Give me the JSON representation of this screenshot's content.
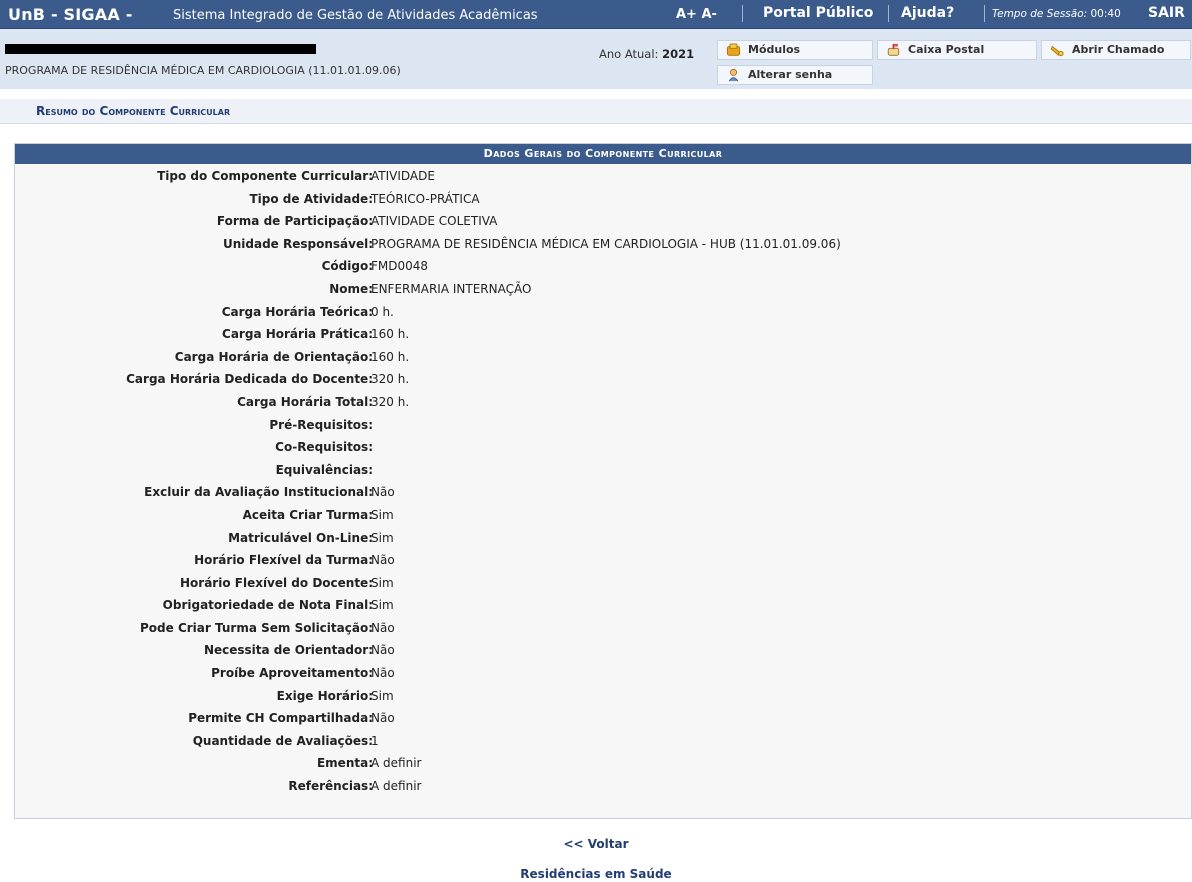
{
  "topbar": {
    "system": "UnB - SIGAA -",
    "system_desc": "Sistema Integrado de Gestão de Atividades Acadêmicas",
    "font_controls": "A+ A-",
    "portal": "Portal Público",
    "help": "Ajuda?",
    "session_label": "Tempo de Sessão: ",
    "session_time": "00:40",
    "logout": "SAIR"
  },
  "header": {
    "unidade": "PROGRAMA DE RESIDÊNCIA MÉDICA EM CARDIOLOGIA (11.01.01.09.06)",
    "ano_label": "Ano Atual: ",
    "ano_value": "2021",
    "buttons": {
      "modulos": "Módulos",
      "caixa_postal": "Caixa Postal",
      "abrir_chamado": "Abrir Chamado",
      "alterar_senha": "Alterar senha"
    }
  },
  "breadcrumb": "Resumo do Componente Curricular",
  "panel": {
    "caption": "Dados Gerais do Componente Curricular",
    "rows": [
      {
        "label": "Tipo do Componente Curricular:",
        "value": "ATIVIDADE"
      },
      {
        "label": "Tipo de Atividade:",
        "value": "TEÓRICO-PRÁTICA"
      },
      {
        "label": "Forma de Participação:",
        "value": "ATIVIDADE COLETIVA"
      },
      {
        "label": "Unidade Responsável:",
        "value": "PROGRAMA DE RESIDÊNCIA MÉDICA EM CARDIOLOGIA - HUB (11.01.01.09.06)"
      },
      {
        "label": "Código:",
        "value": "FMD0048"
      },
      {
        "label": "Nome:",
        "value": "ENFERMARIA INTERNAÇÃO"
      },
      {
        "label": "Carga Horária Teórica:",
        "value": "0 h."
      },
      {
        "label": "Carga Horária Prática:",
        "value": "160 h."
      },
      {
        "label": "Carga Horária de Orientação:",
        "value": "160 h."
      },
      {
        "label": "Carga Horária Dedicada do Docente:",
        "value": "320 h."
      },
      {
        "label": "Carga Horária Total:",
        "value": "320 h."
      },
      {
        "label": "Pré-Requisitos:",
        "value": ""
      },
      {
        "label": "Co-Requisitos:",
        "value": ""
      },
      {
        "label": "Equivalências:",
        "value": ""
      },
      {
        "label": "Excluir da Avaliação Institucional:",
        "value": "Não"
      },
      {
        "label": "Aceita Criar Turma:",
        "value": "Sim"
      },
      {
        "label": "Matriculável On-Line:",
        "value": "Sim"
      },
      {
        "label": "Horário Flexível da Turma:",
        "value": "Não"
      },
      {
        "label": "Horário Flexível do Docente:",
        "value": "Sim"
      },
      {
        "label": "Obrigatoriedade de Nota Final:",
        "value": "Sim"
      },
      {
        "label": "Pode Criar Turma Sem Solicitação:",
        "value": "Não"
      },
      {
        "label": "Necessita de Orientador:",
        "value": "Não"
      },
      {
        "label": "Proíbe Aproveitamento:",
        "value": "Não"
      },
      {
        "label": "Exige Horário:",
        "value": "Sim"
      },
      {
        "label": "Permite CH Compartilhada:",
        "value": "Não"
      },
      {
        "label": "Quantidade de Avaliações:",
        "value": "1"
      },
      {
        "label": "Ementa:",
        "value": "A definir"
      },
      {
        "label": "Referências:",
        "value": "A definir"
      }
    ]
  },
  "footer": {
    "voltar": "<< Voltar",
    "residencias": "Residências em Saúde"
  },
  "colors": {
    "header_blue": "#3b5b8c",
    "link_blue": "#223d73",
    "info_bg": "#dce6f2"
  },
  "icons": [
    "modules-icon",
    "mailbox-icon",
    "ticket-icon",
    "password-icon"
  ]
}
